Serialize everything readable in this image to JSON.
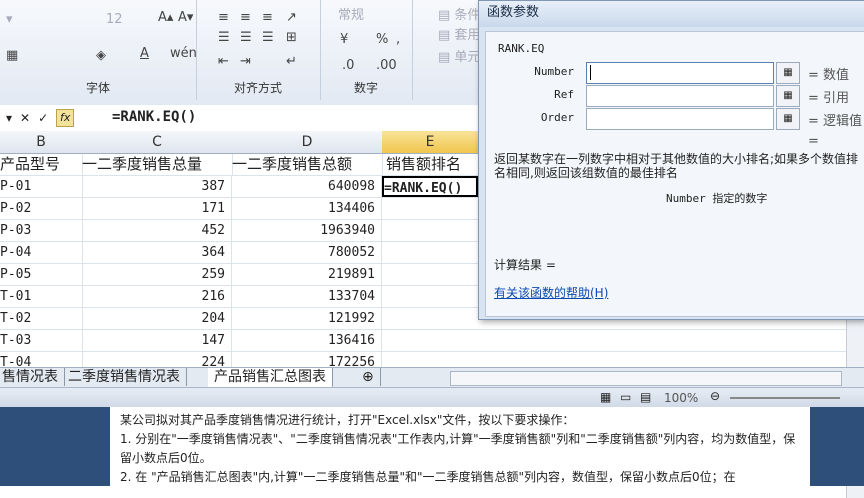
{
  "ribbon": {
    "font_size": "12",
    "number_format": "常规",
    "groups": {
      "font": "字体",
      "alignment": "对齐方式",
      "number": "数字"
    },
    "styles": {
      "conditional": "条件",
      "table": "套用",
      "cell": "单元"
    }
  },
  "formula_bar": {
    "formula": "=RANK.EQ()"
  },
  "sheet": {
    "col_headers": [
      "B",
      "C",
      "D",
      "E"
    ],
    "headers": [
      "产品型号",
      "一二季度销售总量",
      "一二季度销售总额",
      "销售额排名"
    ],
    "rows": [
      [
        "P-01",
        "387",
        "640098"
      ],
      [
        "P-02",
        "171",
        "134406"
      ],
      [
        "P-03",
        "452",
        "1963940"
      ],
      [
        "P-04",
        "364",
        "780052"
      ],
      [
        "P-05",
        "259",
        "219891"
      ],
      [
        "T-01",
        "216",
        "133704"
      ],
      [
        "T-02",
        "204",
        "121992"
      ],
      [
        "T-03",
        "147",
        "136416"
      ],
      [
        "T-04",
        "224",
        "172256"
      ]
    ],
    "active_cell_text": "=RANK.EQ()",
    "tabs": [
      "售情况表",
      "二季度销售情况表",
      "产品销售汇总图表"
    ]
  },
  "status": {
    "zoom": "100%"
  },
  "dialog": {
    "title": "函数参数",
    "function_name": "RANK.EQ",
    "args": [
      {
        "label": "Number",
        "value": "= 数值"
      },
      {
        "label": "Ref",
        "value": "= 引用"
      },
      {
        "label": "Order",
        "value": "= 逻辑值"
      }
    ],
    "extra_equals": "=",
    "description": "返回某数字在一列数字中相对于其他数值的大小排名;如果多个数值排名相同,则返回该组数值的最佳排名",
    "arg_description": "Number  指定的数字",
    "result_label": "计算结果 =",
    "help_link": "有关该函数的帮助(H)"
  },
  "document": {
    "lines": [
      "某公司拟对其产品季度销售情况进行统计，打开\"Excel.xlsx\"文件，按以下要求操作：",
      "1. 分别在\"一季度销售情况表\"、\"二季度销售情况表\"工作表内,计算\"一季度销售额\"列和\"二季度销售额\"列内容，均为数值型，保留小数点后0位。",
      "2. 在 \"产品销售汇总图表\"内,计算\"一二季度销售总量\"和\"一二季度销售总额\"列内容，数值型，保留小数点后0位；在"
    ]
  }
}
